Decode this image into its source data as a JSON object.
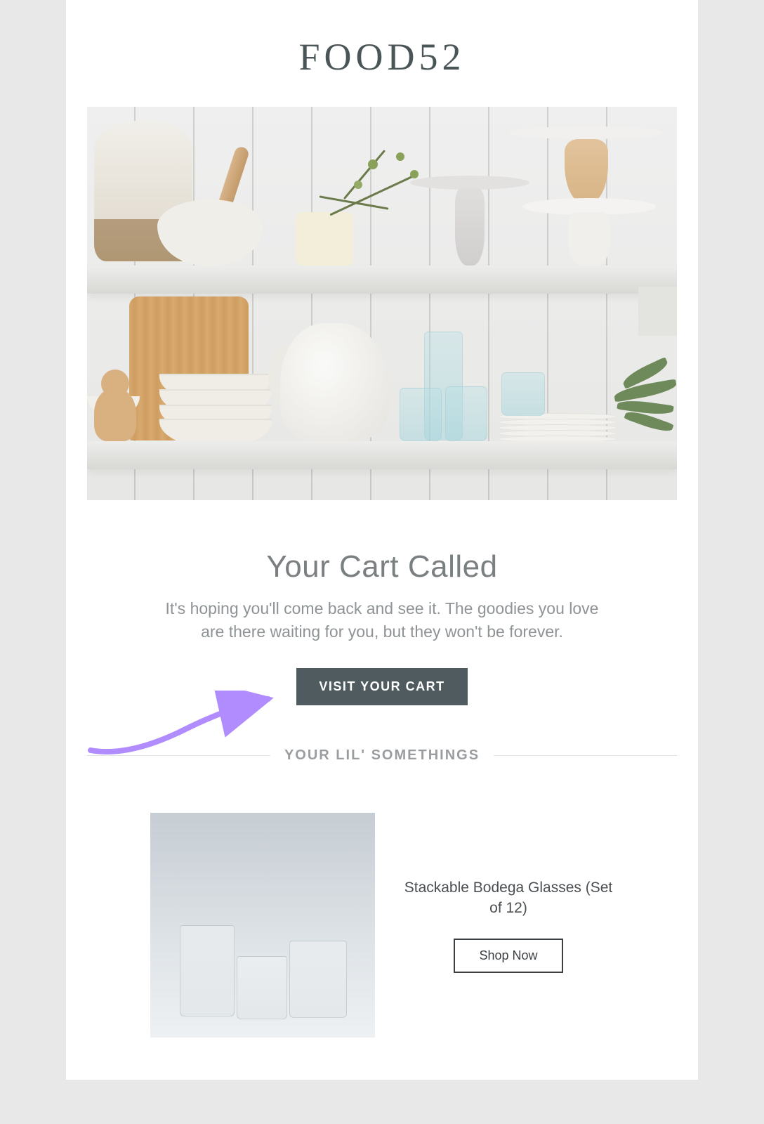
{
  "brand": {
    "logo_text": "FOOD52"
  },
  "hero": {
    "alt": "Kitchen shelves with ceramics, glassware and plants"
  },
  "headline": "Your Cart Called",
  "body": "It's hoping you'll come back and see it. The goodies you love are there waiting for you, but they won't be forever.",
  "cta": {
    "label": "VISIT YOUR CART"
  },
  "annotation": {
    "arrow_color": "#b18cff"
  },
  "section": {
    "label": "YOUR LIL' SOMETHINGS"
  },
  "product": {
    "name": "Stackable Bodega Glasses (Set of 12)",
    "cta_label": "Shop Now",
    "image_alt": "Three clear stackable bodega glasses"
  }
}
